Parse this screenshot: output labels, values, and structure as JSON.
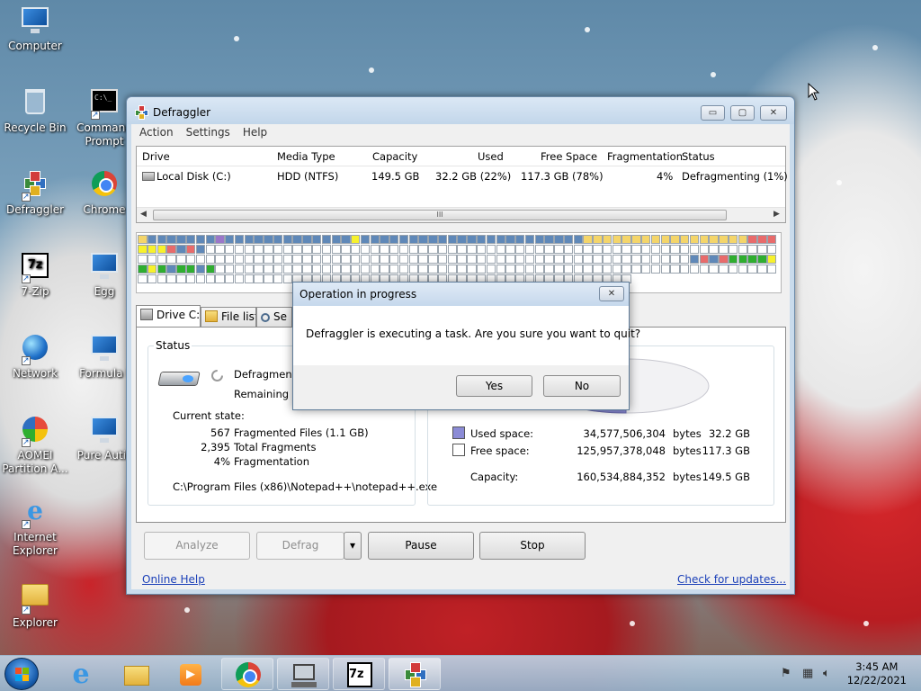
{
  "desktop": {
    "icons": [
      {
        "label": "Computer"
      },
      {
        "label": "Recycle Bin"
      },
      {
        "label": "Command Prompt"
      },
      {
        "label": "Defraggler"
      },
      {
        "label": "Chrome"
      },
      {
        "label": "7-Zip"
      },
      {
        "label": "Egg"
      },
      {
        "label": "Network"
      },
      {
        "label": "Formula I"
      },
      {
        "label": "AOMEI Partition A..."
      },
      {
        "label": "Pure Autis"
      },
      {
        "label": "Internet Explorer"
      },
      {
        "label": "Explorer"
      }
    ]
  },
  "window": {
    "title": "Defraggler",
    "controls": {
      "minimize": "▭",
      "maximize": "▢",
      "close": "✕"
    },
    "menu": [
      "Action",
      "Settings",
      "Help"
    ],
    "drive_list": {
      "columns": [
        "Drive",
        "Media Type",
        "Capacity",
        "Used",
        "Free Space",
        "Fragmentation",
        "Status"
      ],
      "rows": [
        {
          "drive": "Local Disk (C:)",
          "media": "HDD (NTFS)",
          "capacity": "149.5 GB",
          "used": "32.2 GB (22%)",
          "free": "117.3 GB (78%)",
          "frag": "4%",
          "status": "Defragmenting (1%)"
        }
      ],
      "scroll_grip": "III"
    },
    "tabs": [
      "Drive C:",
      "File list",
      "Se"
    ],
    "status_group": {
      "label": "Status",
      "activity": "Defragmentin",
      "remaining": "Remaining tim",
      "current_state_label": "Current state:",
      "stats": [
        {
          "value": "567",
          "label": "Fragmented Files (1.1 GB)"
        },
        {
          "value": "2,395",
          "label": "Total Fragments"
        },
        {
          "value": "4%",
          "label": "Fragmentation"
        }
      ],
      "current_file": "C:\\Program Files (x86)\\Notepad++\\notepad++.exe"
    },
    "space": {
      "used_label": "Used space:",
      "used_bytes": "34,577,506,304",
      "used_gb": "32.2 GB",
      "free_label": "Free space:",
      "free_bytes": "125,957,378,048",
      "free_gb": "117.3 GB",
      "capacity_label": "Capacity:",
      "capacity_bytes": "160,534,884,352",
      "capacity_gb": "149.5 GB",
      "bytes_unit": "bytes",
      "used_fraction": 0.22,
      "used_color": "#8b8bd6",
      "free_color": "#ffffff"
    },
    "buttons": {
      "analyze": "Analyze",
      "defrag": "Defrag",
      "pause": "Pause",
      "stop": "Stop",
      "dropdown": "▾"
    },
    "links": {
      "help": "Online Help",
      "updates": "Check for updates..."
    }
  },
  "dialog": {
    "title": "Operation in progress",
    "message": "Defraggler is executing a task. Are you sure you want to quit?",
    "yes": "Yes",
    "no": "No",
    "close": "✕"
  },
  "taskbar": {
    "time": "3:45 AM",
    "date": "12/22/2021",
    "apps": [
      "internet-explorer",
      "file-explorer",
      "media-player",
      "chrome",
      "network-tool",
      "7-zip",
      "defraggler"
    ]
  },
  "colors": {
    "block_blue": "#5f88b8",
    "block_yellow": "#f4d56a",
    "block_green": "#2fae2f",
    "block_red": "#e86b6b",
    "block_purple": "#9b77c9",
    "block_bright_yellow": "#f7f12c",
    "block_empty": "#ffffff",
    "link": "#1a3fb8"
  }
}
